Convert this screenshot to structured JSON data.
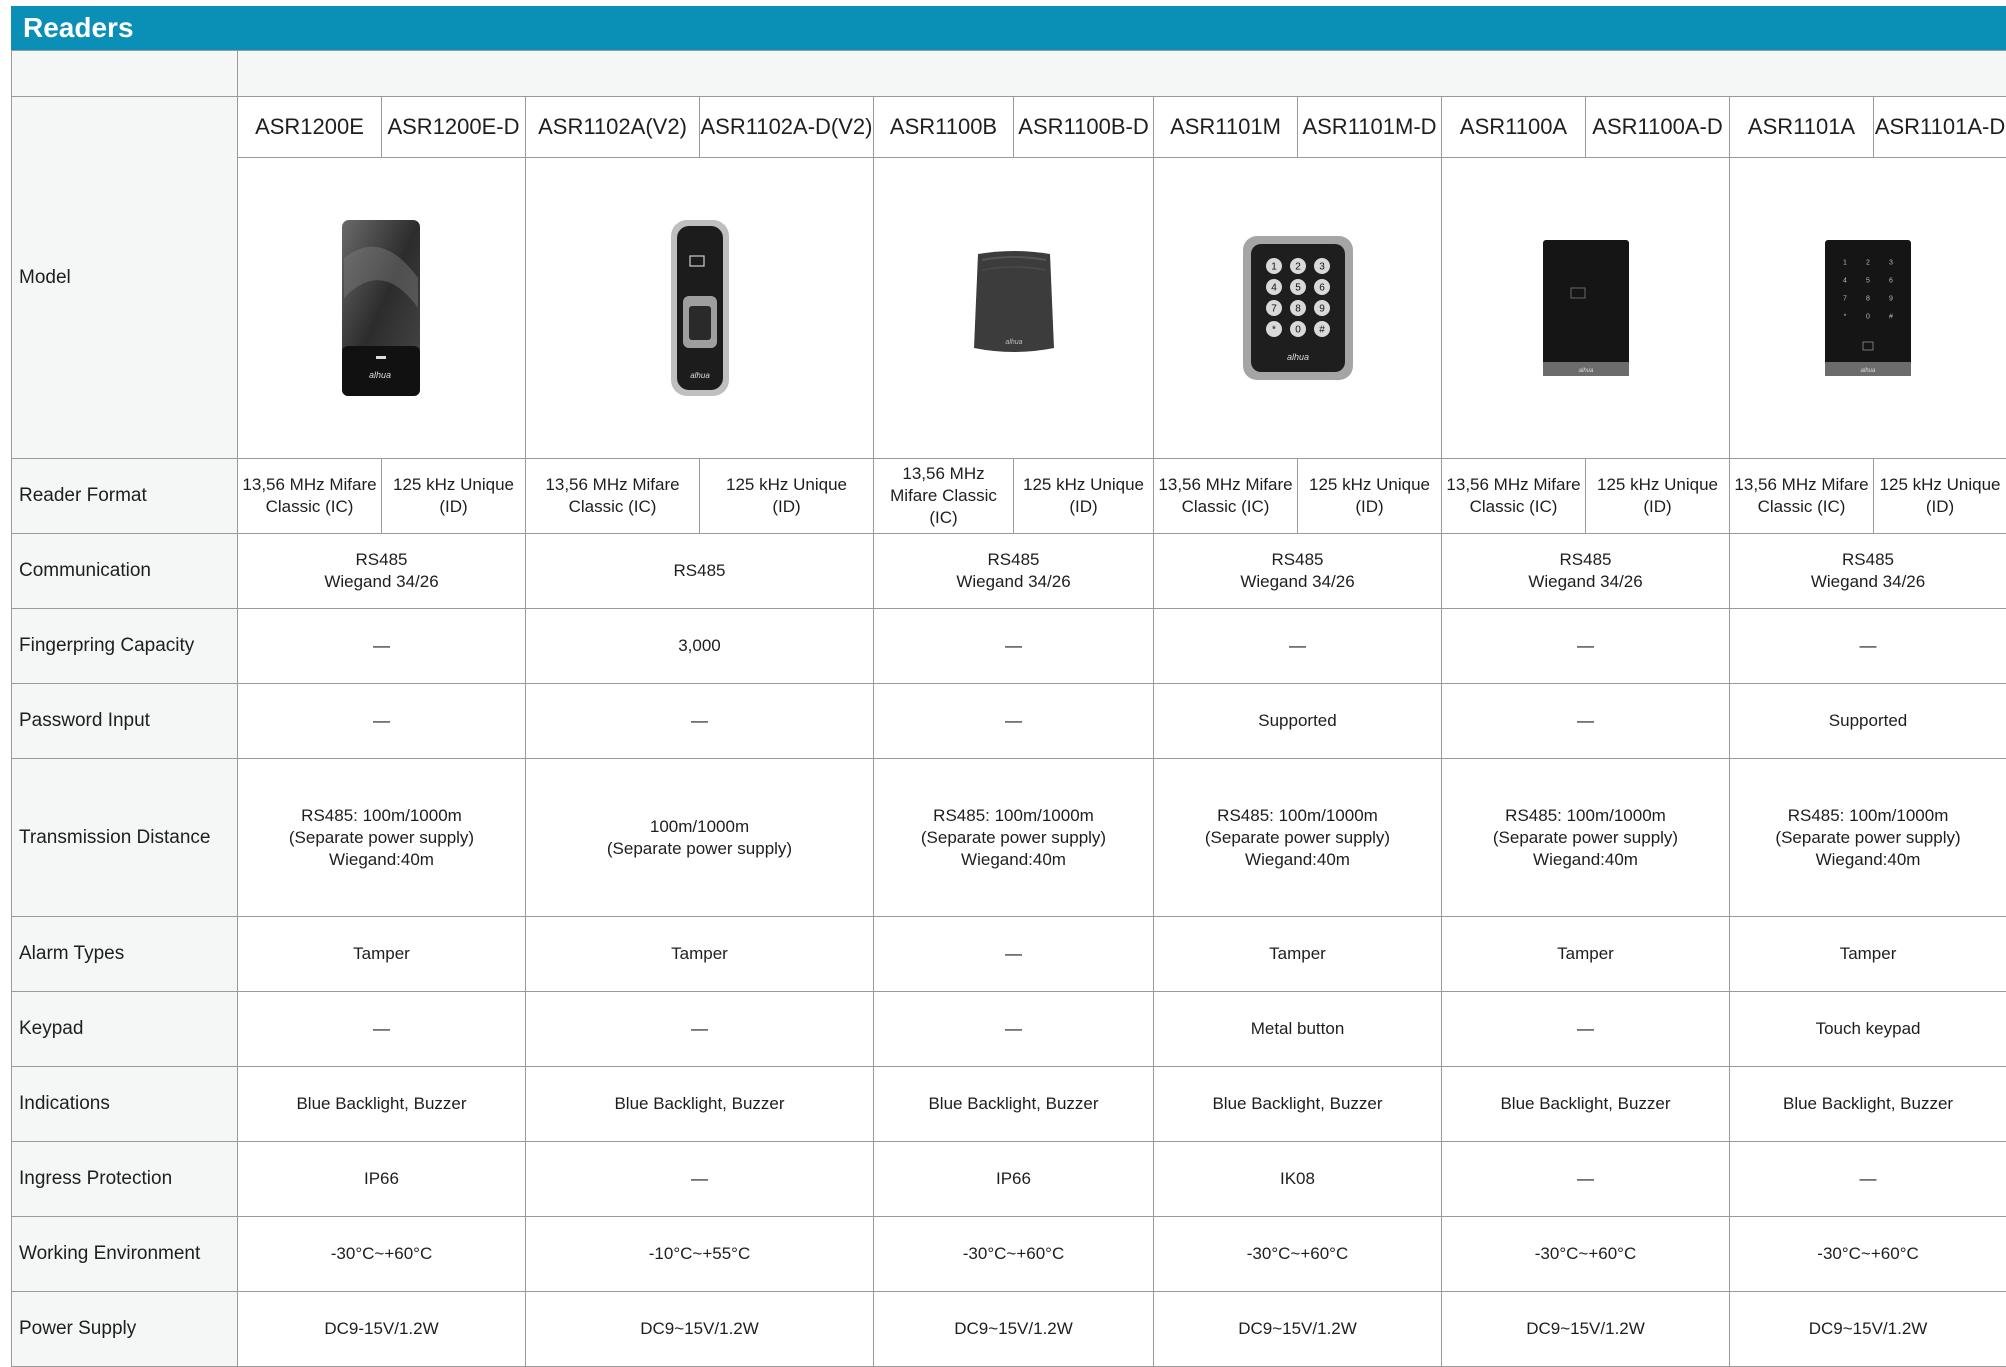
{
  "page": {
    "title": "Readers"
  },
  "models": [
    "ASR1200E",
    "ASR1200E-D",
    "ASR1102A(V2)",
    "ASR1102A-D(V2)",
    "ASR1100B",
    "ASR1100B-D",
    "ASR1101M",
    "ASR1101M-D",
    "ASR1100A",
    "ASR1100A-D",
    "ASR1101A",
    "ASR1101A-D"
  ],
  "product_images": [
    {
      "name": "ASR1200E reader",
      "brand": "alhua"
    },
    {
      "name": "ASR1102A reader with fingerprint sensor",
      "brand": "alhua"
    },
    {
      "name": "ASR1100B reader",
      "brand": "alhua"
    },
    {
      "name": "ASR1101M reader with metal keypad",
      "brand": "alhua",
      "keys": [
        "1",
        "2",
        "3",
        "4",
        "5",
        "6",
        "7",
        "8",
        "9",
        "*",
        "0",
        "#"
      ]
    },
    {
      "name": "ASR1100A reader",
      "brand": "alhua"
    },
    {
      "name": "ASR1101A reader with touch keypad",
      "brand": "alhua",
      "keys": [
        "1",
        "2",
        "3",
        "4",
        "5",
        "6",
        "7",
        "8",
        "9",
        "*",
        "0",
        "#"
      ]
    }
  ],
  "rows": {
    "model": {
      "label": "Model"
    },
    "reader_format": {
      "label": "Reader Format",
      "values": [
        "13,56 MHz Mifare\nClassic (IC)",
        "125 kHz Unique\n(ID)",
        "13,56 MHz Mifare\nClassic (IC)",
        "125 kHz Unique\n(ID)",
        "13,56 MHz\nMifare Classic (IC)",
        "125 kHz Unique\n(ID)",
        "13,56 MHz Mifare\nClassic (IC)",
        "125 kHz Unique\n(ID)",
        "13,56 MHz Mifare\nClassic (IC)",
        "125 kHz Unique\n(ID)",
        "13,56 MHz Mifare\nClassic (IC)",
        "125 kHz Unique\n(ID)"
      ]
    },
    "communication": {
      "label": "Communication",
      "values": [
        "RS485\nWiegand 34/26",
        "RS485",
        "RS485\nWiegand 34/26",
        "RS485\nWiegand 34/26",
        "RS485\nWiegand 34/26",
        "RS485\nWiegand 34/26"
      ]
    },
    "fingerprint_capacity": {
      "label": "Fingerpring Capacity",
      "values": [
        "—",
        "3,000",
        "—",
        "—",
        "—",
        "—"
      ]
    },
    "password_input": {
      "label": "Password Input",
      "values": [
        "—",
        "—",
        "—",
        "Supported",
        "—",
        "Supported"
      ]
    },
    "transmission_distance": {
      "label": "Transmission Distance",
      "values": [
        "RS485: 100m/1000m\n(Separate power supply)\nWiegand:40m",
        "100m/1000m\n(Separate power supply)",
        "RS485: 100m/1000m\n(Separate power supply)\nWiegand:40m",
        "RS485: 100m/1000m\n(Separate power supply)\nWiegand:40m",
        "RS485: 100m/1000m\n(Separate power supply)\nWiegand:40m",
        "RS485: 100m/1000m\n(Separate power supply)\nWiegand:40m"
      ]
    },
    "alarm_types": {
      "label": "Alarm Types",
      "values": [
        "Tamper",
        "Tamper",
        "—",
        "Tamper",
        "Tamper",
        "Tamper"
      ]
    },
    "keypad": {
      "label": "Keypad",
      "values": [
        "—",
        "—",
        "—",
        "Metal button",
        "—",
        "Touch keypad"
      ]
    },
    "indications": {
      "label": "Indications",
      "values": [
        "Blue Backlight, Buzzer",
        "Blue Backlight, Buzzer",
        "Blue Backlight, Buzzer",
        "Blue Backlight, Buzzer",
        "Blue Backlight, Buzzer",
        "Blue Backlight, Buzzer"
      ]
    },
    "ingress_protection": {
      "label": "Ingress Protection",
      "values": [
        "IP66",
        "—",
        "IP66",
        "IK08",
        "—",
        "—"
      ]
    },
    "working_environment": {
      "label": "Working Environment",
      "values": [
        "-30°C~+60°C",
        "-10°C~+55°C",
        "-30°C~+60°C",
        "-30°C~+60°C",
        "-30°C~+60°C",
        "-30°C~+60°C"
      ]
    },
    "power_supply": {
      "label": "Power Supply",
      "values": [
        "DC9-15V/1.2W",
        "DC9~15V/1.2W",
        "DC9~15V/1.2W",
        "DC9~15V/1.2W",
        "DC9~15V/1.2W",
        "DC9~15V/1.2W"
      ]
    }
  },
  "colors": {
    "header_bar": "#0a8fb6",
    "label_bg": "#f5f7f7",
    "grid": "#9a9a9a"
  }
}
